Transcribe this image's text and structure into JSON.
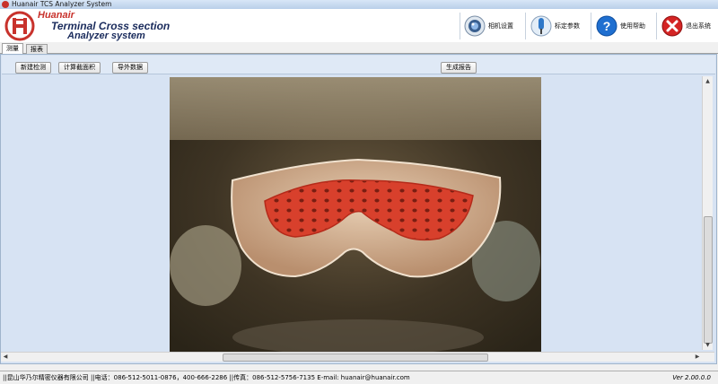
{
  "window": {
    "title": "Huanair TCS Analyzer System"
  },
  "brand": {
    "line1": "Huanair",
    "line2": "Terminal Cross section",
    "line3": "Analyzer system"
  },
  "toolbar": [
    {
      "label": "相机设置",
      "icon": "camera-icon"
    },
    {
      "label": "标定参数",
      "icon": "calibration-icon"
    },
    {
      "label": "使用帮助",
      "icon": "help-icon"
    },
    {
      "label": "退出系统",
      "icon": "exit-icon"
    }
  ],
  "tabs": [
    {
      "label": "测量",
      "active": true
    },
    {
      "label": "报表",
      "active": false
    }
  ],
  "actions": {
    "new_detect": "新建检测",
    "calc_area": "计算截面积",
    "export": "导外数据",
    "report": "生成报告"
  },
  "status": {
    "contact": "||昆山华乃尔精密仪器有限公司   ||电话：086-512-5011-0876，400-666-2286   ||传真：086-512-5756-7135 E-mail: huanair@huanair.com",
    "version": "Ver 2.00.0.0"
  },
  "colors": {
    "accent": "#c8322c",
    "brand_dark": "#1a2b5c",
    "panel_bg": "#d7e3f3"
  }
}
